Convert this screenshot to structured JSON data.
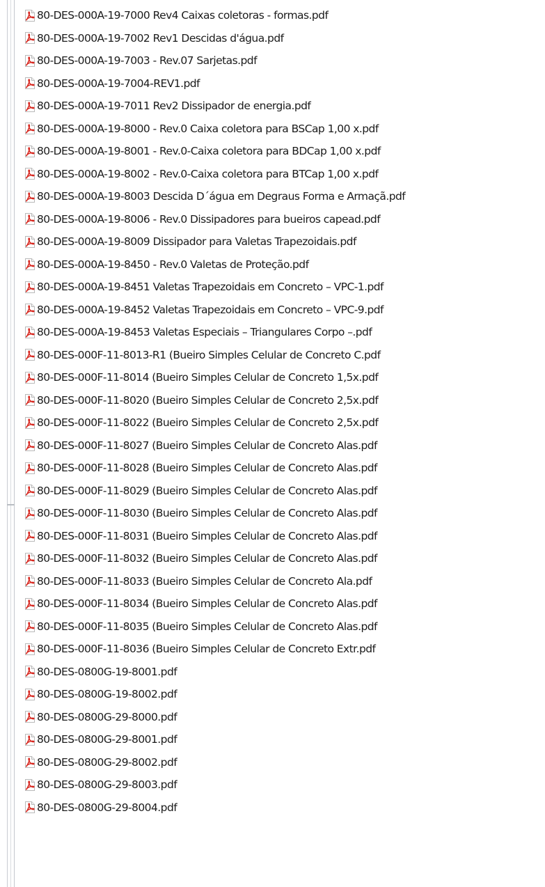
{
  "file_list": {
    "icon": "pdf-file-icon",
    "icon_color": "#d7261e",
    "items": [
      "80-DES-000A-19-7000 Rev4 Caixas coletoras - formas.pdf",
      "80-DES-000A-19-7002 Rev1 Descidas d'água.pdf",
      "80-DES-000A-19-7003 - Rev.07 Sarjetas.pdf",
      "80-DES-000A-19-7004-REV1.pdf",
      "80-DES-000A-19-7011 Rev2 Dissipador de energia.pdf",
      "80-DES-000A-19-8000 - Rev.0 Caixa coletora para BSCap 1,00 x.pdf",
      "80-DES-000A-19-8001 - Rev.0-Caixa coletora para BDCap 1,00 x.pdf",
      "80-DES-000A-19-8002 - Rev.0-Caixa coletora para BTCap 1,00 x.pdf",
      "80-DES-000A-19-8003 Descida D´água em Degraus Forma e Armaçã.pdf",
      "80-DES-000A-19-8006 - Rev.0 Dissipadores para bueiros capead.pdf",
      "80-DES-000A-19-8009 Dissipador para Valetas Trapezoidais.pdf",
      "80-DES-000A-19-8450 - Rev.0 Valetas de Proteção.pdf",
      "80-DES-000A-19-8451 Valetas Trapezoidais em Concreto – VPC-1.pdf",
      "80-DES-000A-19-8452 Valetas Trapezoidais em Concreto – VPC-9.pdf",
      "80-DES-000A-19-8453 Valetas Especiais – Triangulares Corpo –.pdf",
      "80-DES-000F-11-8013-R1 (Bueiro Simples Celular de Concreto C.pdf",
      "80-DES-000F-11-8014 (Bueiro Simples Celular de Concreto 1,5x.pdf",
      "80-DES-000F-11-8020 (Bueiro Simples Celular de Concreto 2,5x.pdf",
      "80-DES-000F-11-8022 (Bueiro Simples Celular de Concreto 2,5x.pdf",
      "80-DES-000F-11-8027 (Bueiro Simples Celular de Concreto Alas.pdf",
      "80-DES-000F-11-8028 (Bueiro Simples Celular de Concreto Alas.pdf",
      "80-DES-000F-11-8029 (Bueiro Simples Celular de Concreto Alas.pdf",
      "80-DES-000F-11-8030 (Bueiro Simples Celular de Concreto Alas.pdf",
      "80-DES-000F-11-8031 (Bueiro Simples Celular de Concreto Alas.pdf",
      "80-DES-000F-11-8032 (Bueiro Simples Celular de Concreto Alas.pdf",
      "80-DES-000F-11-8033  (Bueiro Simples Celular de Concreto Ala.pdf",
      "80-DES-000F-11-8034 (Bueiro Simples Celular de Concreto Alas.pdf",
      "80-DES-000F-11-8035 (Bueiro Simples Celular de Concreto Alas.pdf",
      "80-DES-000F-11-8036 (Bueiro Simples Celular de Concreto Extr.pdf",
      "80-DES-0800G-19-8001.pdf",
      "80-DES-0800G-19-8002.pdf",
      "80-DES-0800G-29-8000.pdf",
      "80-DES-0800G-29-8001.pdf",
      "80-DES-0800G-29-8002.pdf",
      "80-DES-0800G-29-8003.pdf",
      "80-DES-0800G-29-8004.pdf"
    ]
  }
}
